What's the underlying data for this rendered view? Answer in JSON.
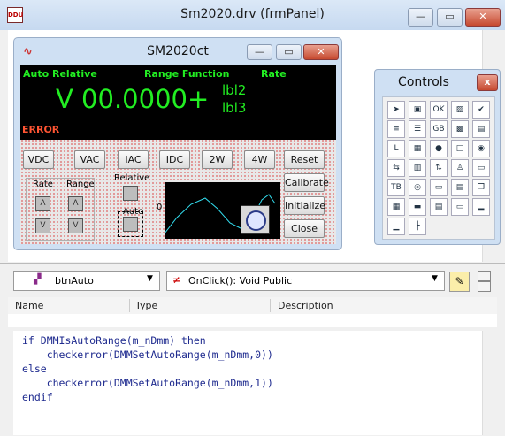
{
  "main_window": {
    "title": "Sm2020.drv (frmPanel)",
    "app_icon_text": "DDU",
    "caption_buttons": {
      "minimize": "—",
      "maximize": "▭",
      "close": "✕"
    }
  },
  "form": {
    "title": "SM2020ct",
    "caption_buttons": {
      "minimize": "—",
      "maximize": "▭",
      "close": "✕"
    },
    "display": {
      "label_auto_relative": "Auto Relative",
      "label_range_function": "Range Function",
      "label_rate": "Rate",
      "reading": "V 00.0000+",
      "lbl2": "lbl2",
      "lbl3": "lbl3",
      "error": "ERROR"
    },
    "function_buttons": [
      "VDC",
      "VAC",
      "IAC",
      "IDC",
      "2W",
      "4W"
    ],
    "reset": "Reset",
    "calibrate": "Calibrate",
    "initialize": "Initialize",
    "close": "Close",
    "rate_label": "Rate",
    "range_label": "Range",
    "relative_label": "Relative",
    "auto_label": "Auto",
    "graph_zero": "0"
  },
  "controls": {
    "title": "Controls",
    "close": "x",
    "tools": [
      "pointer",
      "picture",
      "ok-button",
      "image",
      "checkbox",
      "text-box",
      "list",
      "gb-frame",
      "picture-2",
      "combo",
      "label",
      "list-box",
      "globe",
      "frame",
      "option",
      "hscroll",
      "grid",
      "vscroll",
      "user",
      "folder",
      "tb",
      "tab",
      "form",
      "menu",
      "window",
      "timer",
      "spin",
      "dir",
      "drive",
      "panel",
      "meter",
      "tree"
    ]
  },
  "editor": {
    "object_combo": "btnAuto",
    "event_combo": "OnClick(): Void Public",
    "columns": [
      "Name",
      "Type",
      "Description"
    ],
    "code_lines": [
      "if DMMIsAutoRange(m_nDmm) then",
      "    checkerror(DMMSetAutoRange(m_nDmm,0))",
      "else",
      "    checkerror(DMMSetAutoRange(m_nDmm,1))",
      "endif"
    ]
  },
  "colors": {
    "display_text": "#22ee22",
    "error_text": "#ff5533",
    "code_text": "#1f2b8f",
    "close_red": "#c6492f"
  }
}
